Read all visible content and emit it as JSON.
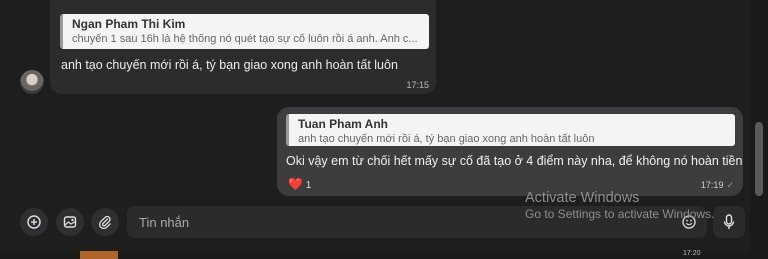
{
  "messages": {
    "incoming": {
      "quote": {
        "author": "Ngan Pham Thi Kim",
        "text": "chuyến 1 sau 16h là hệ thống nó quét tạo sự cố luôn rồi á anh. Anh c..."
      },
      "text": "anh tạo chuyến mới rồi á, tý bạn giao xong anh hoàn tất luôn",
      "time": "17:15"
    },
    "outgoing": {
      "quote": {
        "author": "Tuan Pham Anh",
        "text": "anh tạo chuyến mới rồi á, tý bạn giao xong anh hoàn tất luôn"
      },
      "text": "Oki vậy em từ chối hết mấy sự cố đã tạo ở 4 điểm này nha, để không nó hoàn tiền",
      "reaction": {
        "emoji": "❤️",
        "count": "1"
      },
      "time": "17:19"
    }
  },
  "composer": {
    "placeholder": "Tin nhắn"
  },
  "watermark": {
    "line1": "Activate Windows",
    "line2": "Go to Settings to activate Windows."
  },
  "taskbar": {
    "time": "17:20"
  },
  "colors": {
    "background": "#1e1e1f",
    "incoming_bubble": "#2c2c2e",
    "outgoing_bubble": "#3d3d40",
    "heart": "#e0374a"
  }
}
